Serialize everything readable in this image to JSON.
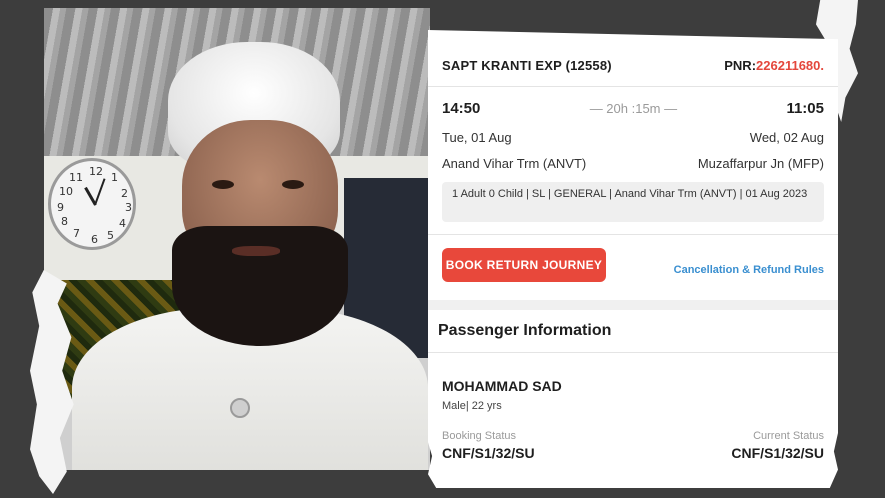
{
  "ticket": {
    "train_name": "SAPT KRANTI EXP (12558)",
    "pnr_label": "PNR:",
    "pnr_value": "226211680.",
    "departure_time": "14:50",
    "duration": "— 20h :15m —",
    "arrival_time": "11:05",
    "departure_date": "Tue, 01 Aug",
    "arrival_date": "Wed, 02 Aug",
    "from_station": "Anand Vihar Trm (ANVT)",
    "to_station": "Muzaffarpur Jn (MFP)",
    "summary": "1 Adult 0 Child  | SL | GENERAL | Anand Vihar Trm (ANVT) | 01 Aug 2023",
    "book_return_label": "BOOK RETURN JOURNEY",
    "rules_link": "Cancellation & Refund Rules",
    "section_title": "Passenger Information",
    "passenger": {
      "name": "MOHAMMAD SAD",
      "meta": "Male| 22 yrs",
      "booking_status_label": "Booking Status",
      "booking_status": "CNF/S1/32/SU",
      "current_status_label": "Current Status",
      "current_status": "CNF/S1/32/SU"
    }
  },
  "photo": {
    "clock_numbers": [
      "12",
      "1",
      "2",
      "3",
      "4",
      "5",
      "6",
      "7",
      "8",
      "9",
      "10",
      "11"
    ]
  },
  "colors": {
    "background": "#3d3d3d",
    "accent_red": "#e8483b",
    "link_blue": "#3a8fd0"
  }
}
